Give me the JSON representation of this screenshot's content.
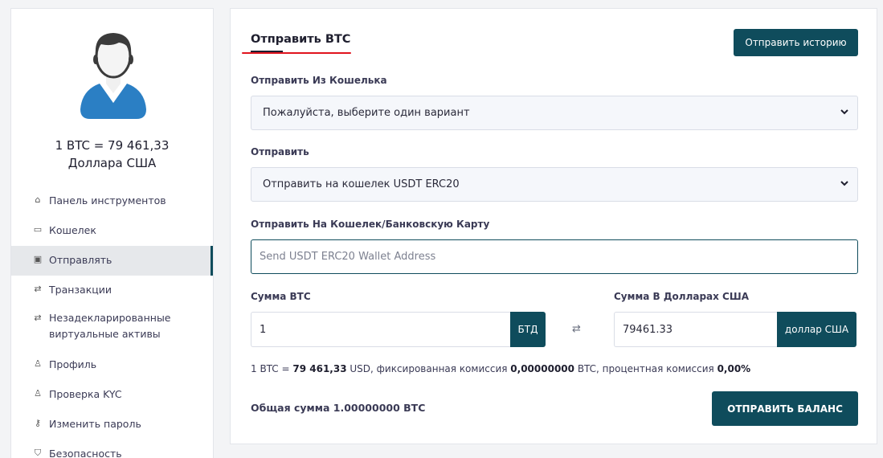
{
  "sidebar": {
    "rate_line1": "1 BTC = 79 461,33",
    "rate_line2": "Доллара США",
    "items": [
      {
        "label": "Панель инструментов",
        "icon": "⌂",
        "icon_name": "home-icon"
      },
      {
        "label": "Кошелек",
        "icon": "▭",
        "icon_name": "wallet-icon"
      },
      {
        "label": "Отправлять",
        "icon": "▣",
        "icon_name": "money-icon",
        "active": true
      },
      {
        "label": "Транзакции",
        "icon": "⇄",
        "icon_name": "transfer-icon"
      },
      {
        "label": "Незадекларированные виртуальные активы",
        "icon": "⇄",
        "icon_name": "transfer-icon"
      },
      {
        "label": "Профиль",
        "icon": "♙",
        "icon_name": "user-icon"
      },
      {
        "label": "Проверка KYC",
        "icon": "♙",
        "icon_name": "user-icon"
      },
      {
        "label": "Изменить пароль",
        "icon": "⚷",
        "icon_name": "key-icon"
      },
      {
        "label": "Безопасность",
        "icon": "⛉",
        "icon_name": "shield-icon"
      }
    ]
  },
  "form": {
    "title": "Отправить BTC",
    "history_button": "Отправить историю",
    "from_wallet_label": "Отправить Из Кошелька",
    "from_wallet_value": "Пожалуйста, выберите один вариант",
    "send_label": "Отправить",
    "send_value": "Отправить на кошелек USDT ERC20",
    "address_label": "Отправить На Кошелек/Банковскую Карту",
    "address_placeholder": "Send USDT ERC20 Wallet Address",
    "amount_btc_label": "Сумма BTC",
    "amount_btc_value": "1",
    "amount_btc_addon": "БТД",
    "amount_usd_label": "Сумма В Долларах США",
    "amount_usd_value": "79461.33",
    "amount_usd_addon": "доллар США",
    "info_prefix": "1 BTC = ",
    "info_rate": "79 461,33",
    "info_mid": " USD, фиксированная комиссия ",
    "info_fixed_fee": "0,00000000",
    "info_mid2": " BTC, процентная комиссия ",
    "info_percent_fee": "0,00%",
    "total": "Общая сумма 1.00000000 BTC",
    "send_button": "ОТПРАВИТЬ БАЛАНС"
  },
  "colors": {
    "accent": "#0f4c5c",
    "underline": "#e0141e",
    "avatar_shirt": "#2b7fc4"
  }
}
